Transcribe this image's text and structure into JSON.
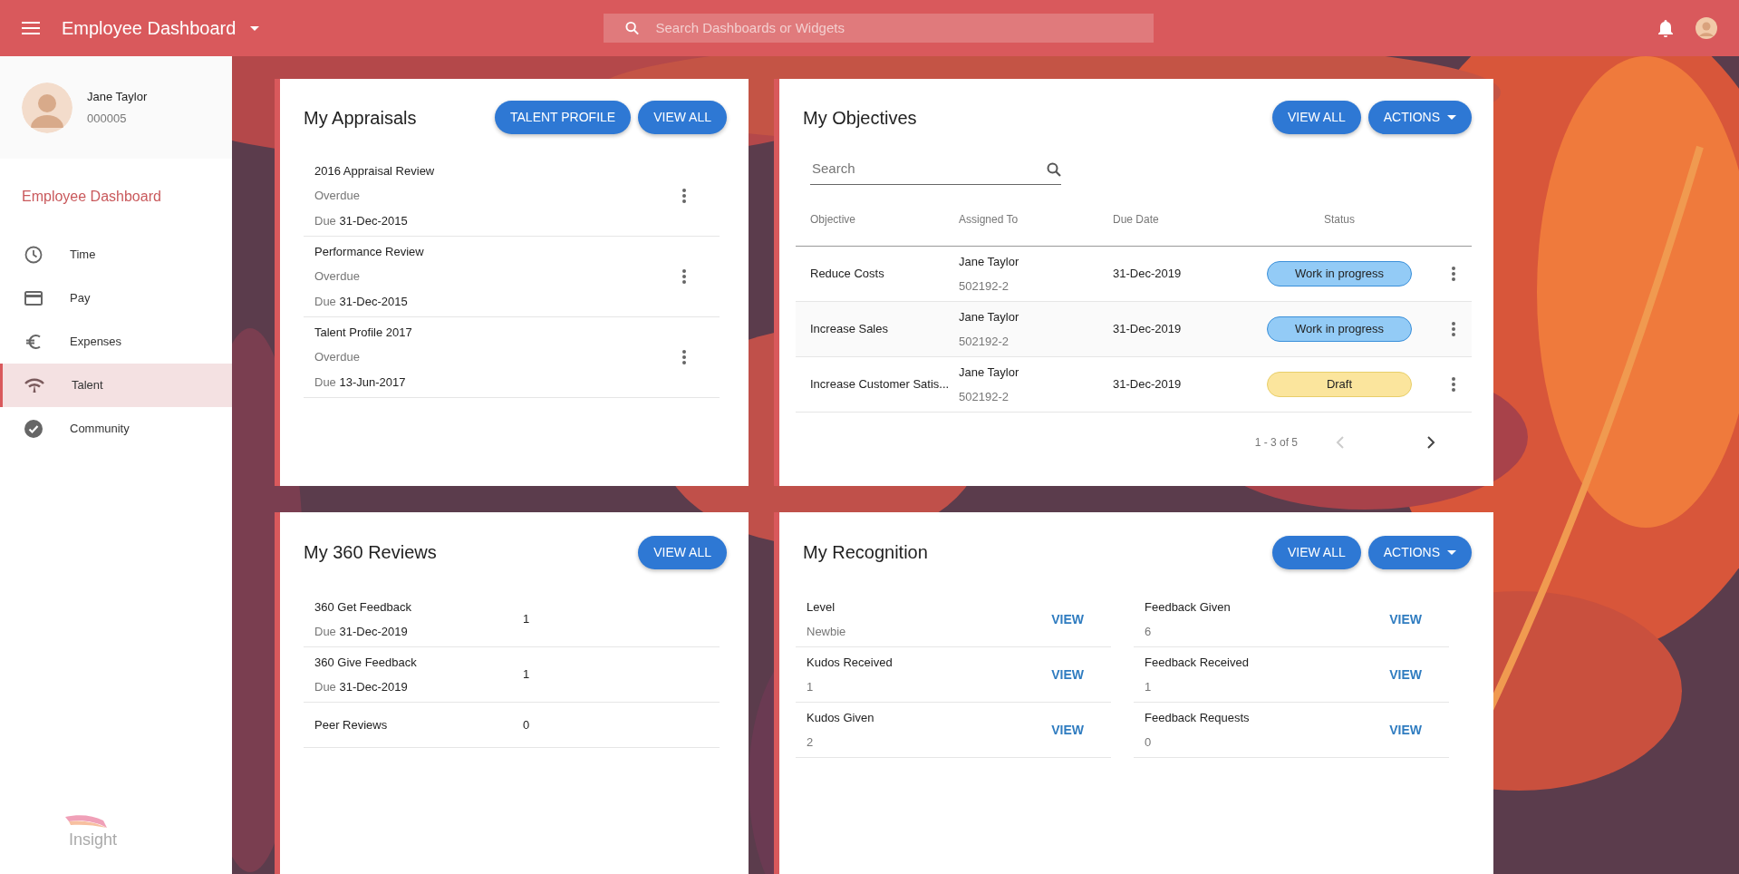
{
  "header": {
    "title": "Employee Dashboard",
    "search_placeholder": "Search Dashboards or Widgets"
  },
  "sidebar": {
    "user": {
      "name": "Jane Taylor",
      "id": "000005"
    },
    "section_title": "Employee Dashboard",
    "items": [
      {
        "label": "Time",
        "selected": false
      },
      {
        "label": "Pay",
        "selected": false
      },
      {
        "label": "Expenses",
        "selected": false
      },
      {
        "label": "Talent",
        "selected": true
      },
      {
        "label": "Community",
        "selected": false
      }
    ],
    "logo": "Insight"
  },
  "appraisals": {
    "title": "My Appraisals",
    "buttons": [
      {
        "label": "TALENT PROFILE",
        "kind": "plain"
      },
      {
        "label": "VIEW ALL",
        "kind": "plain"
      }
    ],
    "items": [
      {
        "title": "2016 Appraisal Review",
        "status": "Overdue",
        "due_label": "Due",
        "due_date": "31-Dec-2015"
      },
      {
        "title": "Performance Review",
        "status": "Overdue",
        "due_label": "Due",
        "due_date": "31-Dec-2015"
      },
      {
        "title": "Talent Profile 2017",
        "status": "Overdue",
        "due_label": "Due",
        "due_date": "13-Jun-2017"
      }
    ]
  },
  "objectives": {
    "title": "My Objectives",
    "buttons": [
      {
        "label": "VIEW ALL",
        "kind": "plain"
      },
      {
        "label": "ACTIONS",
        "kind": "dropdown"
      }
    ],
    "search_placeholder": "Search",
    "columns": [
      "Objective",
      "Assigned To",
      "Due Date",
      "Status"
    ],
    "rows": [
      {
        "objective": "Reduce Costs",
        "assignee": "Jane Taylor",
        "assignee_id": "502192-2",
        "due_date": "31-Dec-2019",
        "status": "Work in progress",
        "kind": "progress"
      },
      {
        "objective": "Increase Sales",
        "assignee": "Jane Taylor",
        "assignee_id": "502192-2",
        "due_date": "31-Dec-2019",
        "status": "Work in progress",
        "kind": "progress"
      },
      {
        "objective": "Increase Customer Satis...",
        "assignee": "Jane Taylor",
        "assignee_id": "502192-2",
        "due_date": "31-Dec-2019",
        "status": "Draft",
        "kind": "draft"
      }
    ],
    "pagination": {
      "range": "1 - 3 of 5",
      "prev_disabled": true,
      "next_disabled": false
    }
  },
  "reviews": {
    "title": "My 360 Reviews",
    "buttons": [
      {
        "label": "VIEW ALL",
        "kind": "plain"
      }
    ],
    "items": [
      {
        "title": "360 Get Feedback",
        "due_label": "Due",
        "due_date": "31-Dec-2019",
        "count": "1"
      },
      {
        "title": "360 Give Feedback",
        "due_label": "Due",
        "due_date": "31-Dec-2019",
        "count": "1"
      },
      {
        "title": "Peer Reviews",
        "count": "0"
      }
    ]
  },
  "recognition": {
    "title": "My Recognition",
    "buttons": [
      {
        "label": "VIEW ALL",
        "kind": "plain"
      },
      {
        "label": "ACTIONS",
        "kind": "dropdown"
      }
    ],
    "columns": [
      [
        {
          "label": "Level",
          "value": "Newbie",
          "action": "VIEW"
        },
        {
          "label": "Kudos Received",
          "value": "1",
          "action": "VIEW"
        },
        {
          "label": "Kudos Given",
          "value": "2",
          "action": "VIEW"
        }
      ],
      [
        {
          "label": "Feedback Given",
          "value": "6",
          "action": "VIEW"
        },
        {
          "label": "Feedback Received",
          "value": "1",
          "action": "VIEW"
        },
        {
          "label": "Feedback Requests",
          "value": "0",
          "action": "VIEW"
        }
      ]
    ]
  }
}
